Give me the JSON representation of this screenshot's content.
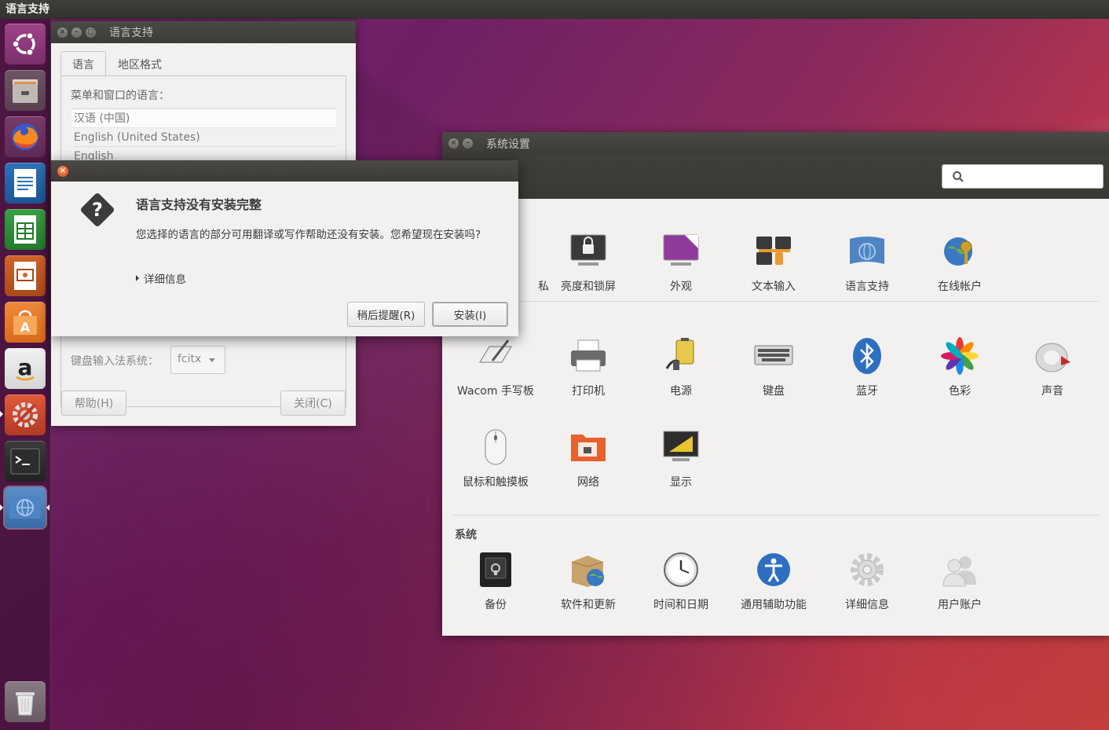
{
  "top_panel": {
    "title": "语言支持"
  },
  "launcher": {
    "items": [
      "ubuntu-dash",
      "files",
      "firefox",
      "libreoffice-writer",
      "libreoffice-calc",
      "libreoffice-impress",
      "software-center",
      "amazon",
      "system-settings",
      "terminal",
      "language-support",
      "trash"
    ]
  },
  "lang_window": {
    "title": "语言支持",
    "tabs": [
      "语言",
      "地区格式"
    ],
    "list_label": "菜单和窗口的语言：",
    "languages": [
      "汉语 (中国)",
      "English (United States)",
      "English"
    ],
    "keyboard_label": "键盘输入法系统：",
    "keyboard_value": "fcitx",
    "help_button": "帮助(H)",
    "close_button": "关闭(C)"
  },
  "dialog": {
    "icon": "question-icon",
    "heading": "语言支持没有安装完整",
    "body": "您选择的语言的部分可用翻译或写作帮助还没有安装。您希望现在安装吗?",
    "details": "详细信息",
    "remind_button": "稍后提醒(R)",
    "install_button": "安装(I)"
  },
  "settings": {
    "title": "系统设置",
    "search_placeholder": "",
    "personal_partial": "私",
    "personal": [
      "亮度和锁屏",
      "外观",
      "文本输入",
      "语言支持",
      "在线帐户"
    ],
    "hardware": [
      "Wacom 手写板",
      "打印机",
      "电源",
      "键盘",
      "蓝牙",
      "色彩",
      "声音",
      "鼠标和触摸板",
      "网络",
      "显示"
    ],
    "system_title": "系统",
    "system": [
      "备份",
      "软件和更新",
      "时间和日期",
      "通用辅助功能",
      "详细信息",
      "用户账户"
    ]
  },
  "colors": {
    "accent_close": "#df4a16",
    "panel": "#3c3b37",
    "launcher_bg": "#46143c"
  }
}
